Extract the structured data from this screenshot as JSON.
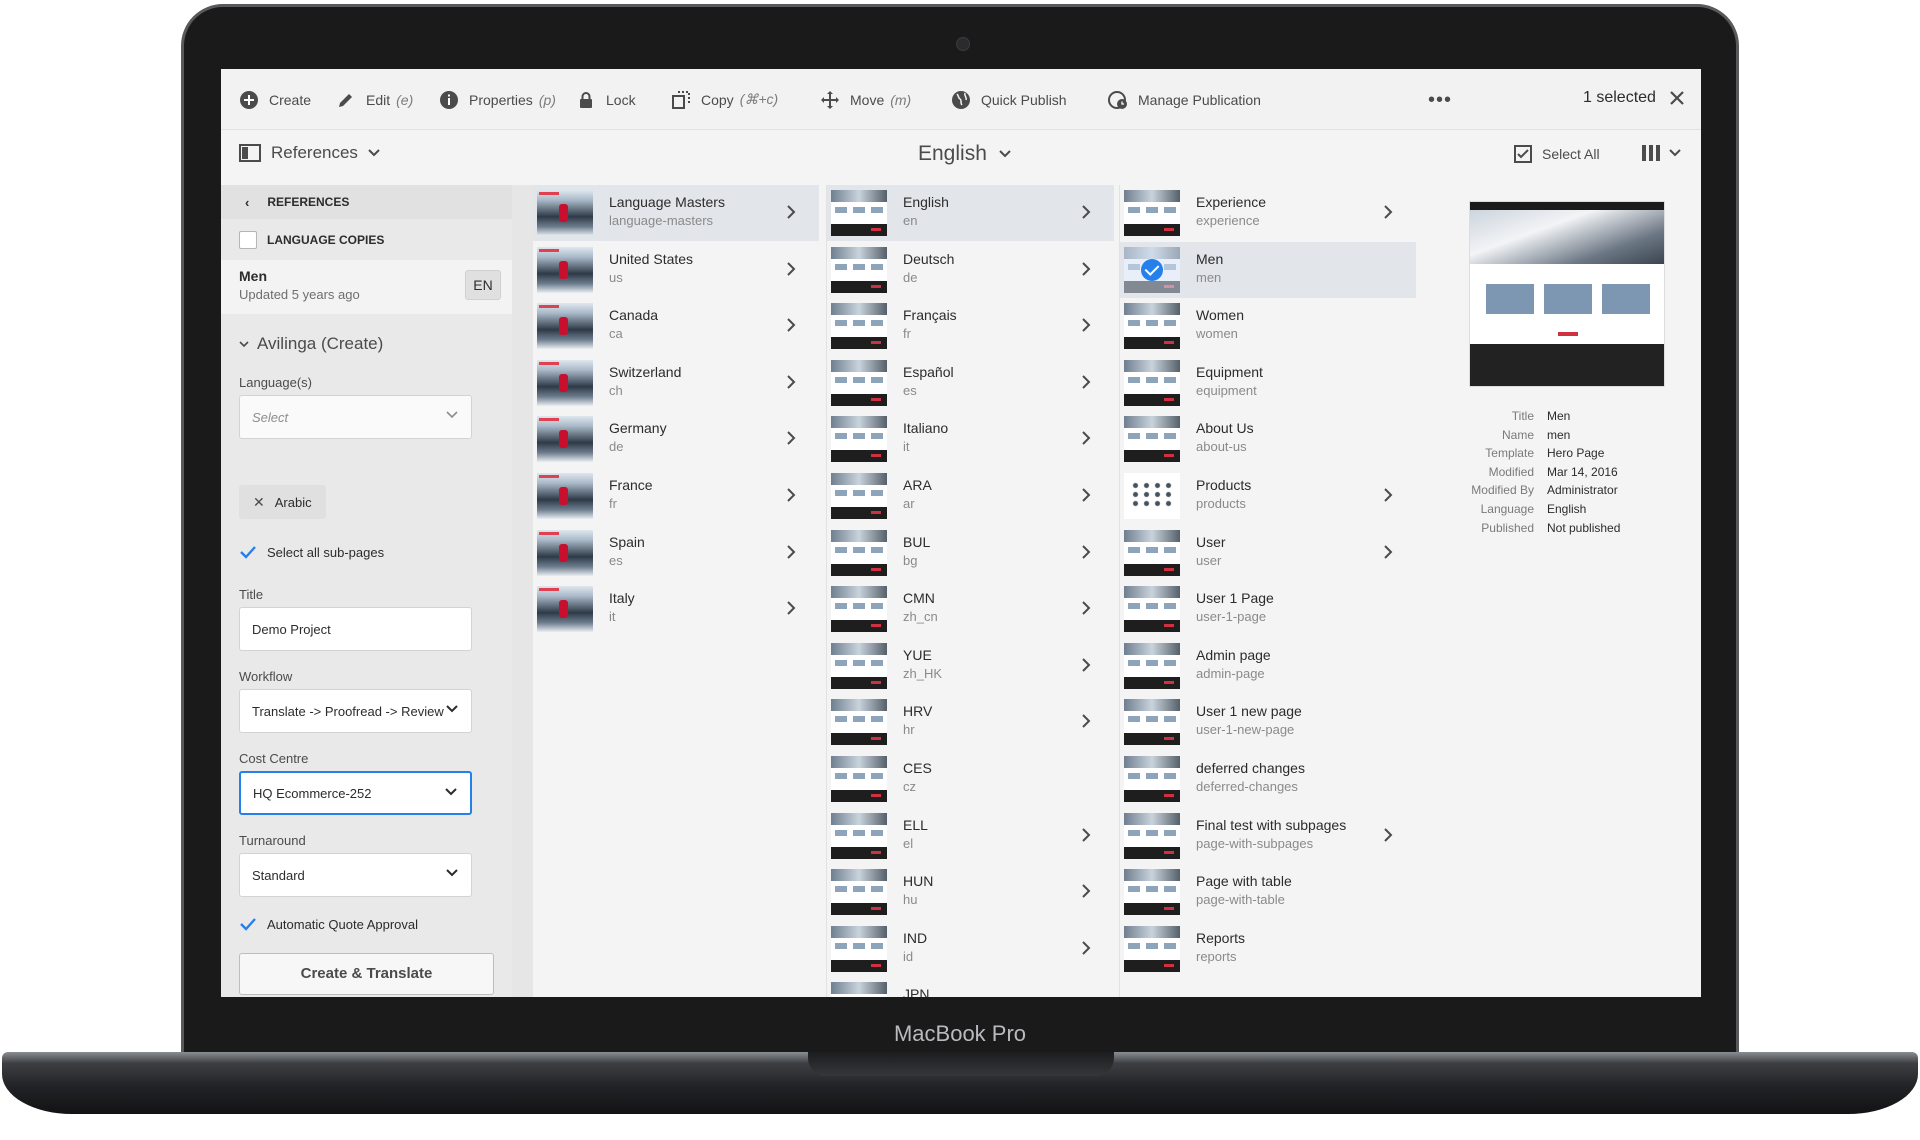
{
  "device_label": "MacBook Pro",
  "action_bar": {
    "create": "Create",
    "edit": "Edit",
    "edit_shortcut": "(e)",
    "properties": "Properties",
    "properties_shortcut": "(p)",
    "lock": "Lock",
    "copy": "Copy",
    "copy_shortcut": "(⌘+c)",
    "move": "Move",
    "move_shortcut": "(m)",
    "quick_publish": "Quick Publish",
    "manage_publication": "Manage Publication",
    "more": "•••",
    "selected_count": "1 selected"
  },
  "header": {
    "rail_toggle": "References",
    "title": "English",
    "select_all": "Select All"
  },
  "rail": {
    "back_label": "REFERENCES",
    "language_copies": "LANGUAGE COPIES",
    "item": {
      "title": "Men",
      "updated": "Updated 5 years ago",
      "lang": "EN"
    },
    "section": "Avilinga (Create)",
    "languages_label": "Language(s)",
    "languages_placeholder": "Select",
    "selected_language": "Arabic",
    "select_subpages": "Select all sub-pages",
    "title_label": "Title",
    "title_value": "Demo Project",
    "workflow_label": "Workflow",
    "workflow_value": "Translate -> Proofread -> Review",
    "cost_label": "Cost Centre",
    "cost_value": "HQ Ecommerce-252",
    "turnaround_label": "Turnaround",
    "turnaround_value": "Standard",
    "auto_quote": "Automatic Quote Approval",
    "submit": "Create & Translate"
  },
  "columns": {
    "sites": [
      {
        "title": "Language Masters",
        "name": "language-masters",
        "chevron": true,
        "selected": true
      },
      {
        "title": "United States",
        "name": "us",
        "chevron": true
      },
      {
        "title": "Canada",
        "name": "ca",
        "chevron": true
      },
      {
        "title": "Switzerland",
        "name": "ch",
        "chevron": true
      },
      {
        "title": "Germany",
        "name": "de",
        "chevron": true
      },
      {
        "title": "France",
        "name": "fr",
        "chevron": true
      },
      {
        "title": "Spain",
        "name": "es",
        "chevron": true
      },
      {
        "title": "Italy",
        "name": "it",
        "chevron": true
      }
    ],
    "languages": [
      {
        "title": "English",
        "name": "en",
        "chevron": true,
        "selected": true
      },
      {
        "title": "Deutsch",
        "name": "de",
        "chevron": true
      },
      {
        "title": "Français",
        "name": "fr",
        "chevron": true
      },
      {
        "title": "Español",
        "name": "es",
        "chevron": true
      },
      {
        "title": "Italiano",
        "name": "it",
        "chevron": true
      },
      {
        "title": "ARA",
        "name": "ar",
        "chevron": true
      },
      {
        "title": "BUL",
        "name": "bg",
        "chevron": true
      },
      {
        "title": "CMN",
        "name": "zh_cn",
        "chevron": true
      },
      {
        "title": "YUE",
        "name": "zh_HK",
        "chevron": true
      },
      {
        "title": "HRV",
        "name": "hr",
        "chevron": true
      },
      {
        "title": "CES",
        "name": "cz",
        "chevron": false
      },
      {
        "title": "ELL",
        "name": "el",
        "chevron": true
      },
      {
        "title": "HUN",
        "name": "hu",
        "chevron": true
      },
      {
        "title": "IND",
        "name": "id",
        "chevron": true
      },
      {
        "title": "JPN",
        "name": "",
        "chevron": false
      }
    ],
    "pages": [
      {
        "title": "Experience",
        "name": "experience",
        "chevron": true
      },
      {
        "title": "Men",
        "name": "men",
        "chevron": false,
        "selected": true,
        "checked": true
      },
      {
        "title": "Women",
        "name": "women",
        "chevron": false
      },
      {
        "title": "Equipment",
        "name": "equipment",
        "chevron": false
      },
      {
        "title": "About Us",
        "name": "about-us",
        "chevron": false
      },
      {
        "title": "Products",
        "name": "products",
        "chevron": true,
        "thumb": "products"
      },
      {
        "title": "User",
        "name": "user",
        "chevron": true
      },
      {
        "title": "User 1 Page",
        "name": "user-1-page",
        "chevron": false
      },
      {
        "title": "Admin page",
        "name": "admin-page",
        "chevron": false
      },
      {
        "title": "User 1 new page",
        "name": "user-1-new-page",
        "chevron": false
      },
      {
        "title": "deferred changes",
        "name": "deferred-changes",
        "chevron": false
      },
      {
        "title": "Final test with subpages",
        "name": "page-with-subpages",
        "chevron": true
      },
      {
        "title": "Page with table",
        "name": "page-with-table",
        "chevron": false
      },
      {
        "title": "Reports",
        "name": "reports",
        "chevron": false
      }
    ]
  },
  "preview": {
    "meta": [
      {
        "label": "Title",
        "value": "Men"
      },
      {
        "label": "Name",
        "value": "men"
      },
      {
        "label": "Template",
        "value": "Hero Page"
      },
      {
        "label": "Modified",
        "value": "Mar 14, 2016"
      },
      {
        "label": "Modified By",
        "value": "Administrator"
      },
      {
        "label": "Language",
        "value": "English"
      },
      {
        "label": "Published",
        "value": "Not published"
      }
    ]
  },
  "colors": {
    "accent": "#2680eb",
    "selection": "#e2e5ea",
    "rail": "#e9e9e9"
  }
}
